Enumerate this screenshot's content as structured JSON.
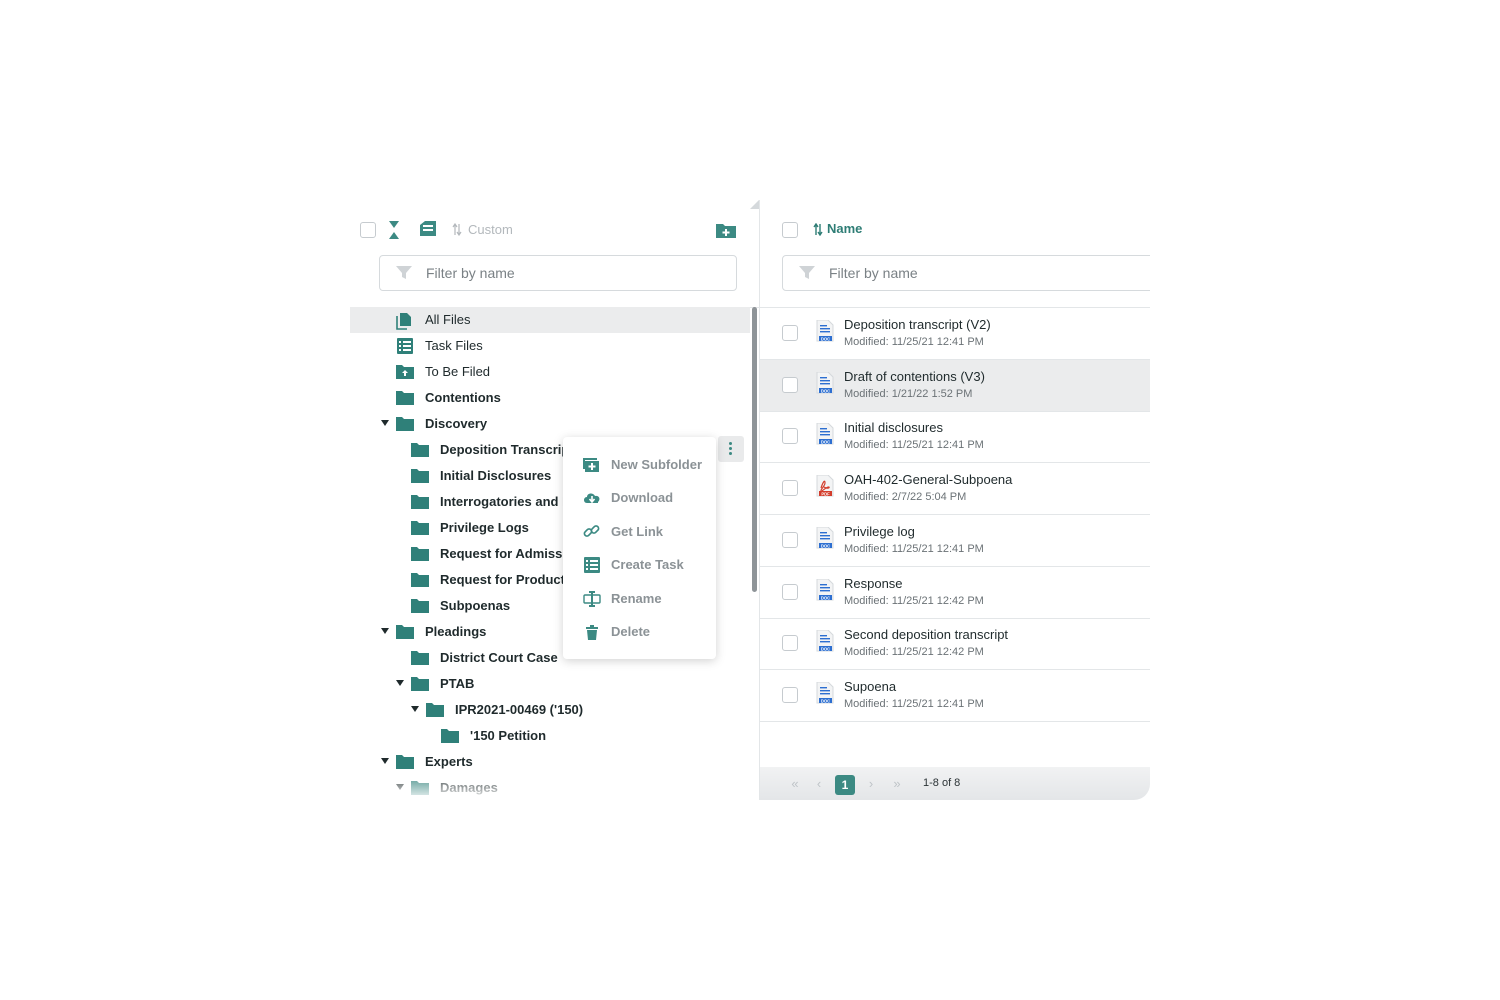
{
  "colors": {
    "accent": "#3c8a83",
    "folder": "#2f8079",
    "selected_bg": "#ebeced",
    "muted_text": "#8b9296"
  },
  "left_panel": {
    "sort_label": "Custom",
    "filter_placeholder": "Filter by name",
    "tree": [
      {
        "label": "All Files",
        "icon": "file-stack-icon",
        "bold": false,
        "selected": true
      },
      {
        "label": "Task Files",
        "icon": "task-list-icon",
        "bold": false
      },
      {
        "label": "To Be Filed",
        "icon": "folder-upload-icon",
        "bold": false
      },
      {
        "label": "Contentions",
        "icon": "folder-icon"
      },
      {
        "label": "Discovery",
        "icon": "folder-icon",
        "expanded": true
      },
      {
        "label": "Deposition Transcript",
        "icon": "folder-icon"
      },
      {
        "label": "Initial Disclosures",
        "icon": "folder-icon"
      },
      {
        "label": "Interrogatories and R",
        "icon": "folder-icon"
      },
      {
        "label": "Privilege Logs",
        "icon": "folder-icon"
      },
      {
        "label": "Request for Admissic",
        "icon": "folder-icon"
      },
      {
        "label": "Request for Productic",
        "icon": "folder-icon"
      },
      {
        "label": "Subpoenas",
        "icon": "folder-icon"
      },
      {
        "label": "Pleadings",
        "icon": "folder-icon",
        "expanded": true
      },
      {
        "label": "District Court Case",
        "icon": "folder-icon"
      },
      {
        "label": "PTAB",
        "icon": "folder-icon",
        "expanded": true
      },
      {
        "label": "IPR2021-00469 ('150)",
        "icon": "folder-icon",
        "expanded": true
      },
      {
        "label": "'150 Petition",
        "icon": "folder-icon"
      },
      {
        "label": "Experts",
        "icon": "folder-icon",
        "expanded": true
      },
      {
        "label": "Damages",
        "icon": "folder-icon",
        "expanded": true
      }
    ],
    "context_menu": [
      {
        "label": "New Subfolder",
        "icon": "new-folder-icon"
      },
      {
        "label": "Download",
        "icon": "cloud-download-icon"
      },
      {
        "label": "Get Link",
        "icon": "link-icon"
      },
      {
        "label": "Create Task",
        "icon": "task-list-icon"
      },
      {
        "label": "Rename",
        "icon": "rename-icon"
      },
      {
        "label": "Delete",
        "icon": "trash-icon"
      }
    ]
  },
  "right_panel": {
    "sort_label": "Name",
    "filter_placeholder": "Filter by name",
    "files": [
      {
        "name": "Deposition transcript (V2)",
        "modified": "Modified: 11/25/21 12:41 PM",
        "type": "DOC"
      },
      {
        "name": "Draft of contentions (V3)",
        "modified": "Modified: 1/21/22 1:52 PM",
        "type": "DOC",
        "selected": true
      },
      {
        "name": "Initial disclosures",
        "modified": "Modified: 11/25/21 12:41 PM",
        "type": "DOC"
      },
      {
        "name": "OAH-402-General-Subpoena",
        "modified": "Modified: 2/7/22 5:04 PM",
        "type": "PDF"
      },
      {
        "name": "Privilege log",
        "modified": "Modified: 11/25/21 12:41 PM",
        "type": "DOC"
      },
      {
        "name": "Response",
        "modified": "Modified: 11/25/21 12:42 PM",
        "type": "DOC"
      },
      {
        "name": "Second deposition transcript",
        "modified": "Modified: 11/25/21 12:42 PM",
        "type": "DOC"
      },
      {
        "name": "Supoena",
        "modified": "Modified: 11/25/21 12:41 PM",
        "type": "DOC"
      }
    ],
    "pagination": {
      "current_page": "1",
      "range_text": "1-8 of 8"
    }
  }
}
